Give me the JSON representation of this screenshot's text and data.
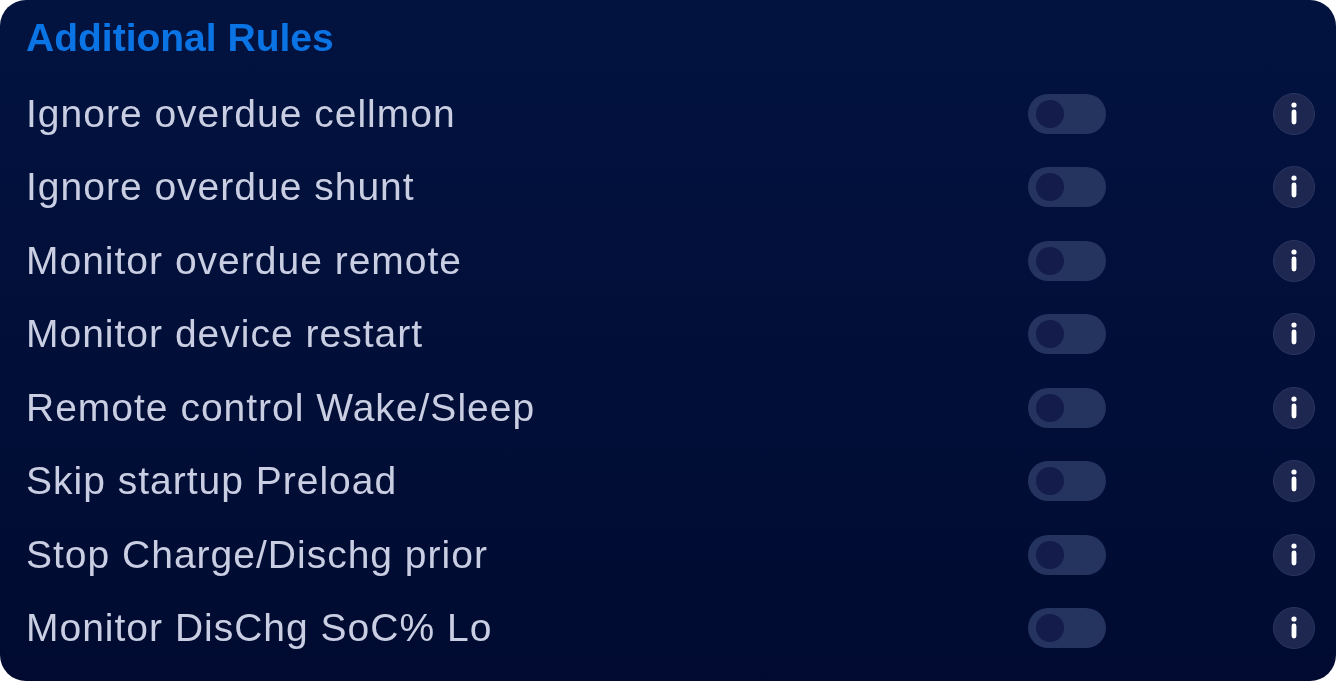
{
  "title": "Additional Rules",
  "rules": [
    {
      "label": "Ignore overdue cellmon",
      "on": false
    },
    {
      "label": "Ignore overdue shunt",
      "on": false
    },
    {
      "label": "Monitor overdue remote",
      "on": false
    },
    {
      "label": "Monitor device restart",
      "on": false
    },
    {
      "label": "Remote control Wake/Sleep",
      "on": false
    },
    {
      "label": "Skip startup Preload",
      "on": false
    },
    {
      "label": "Stop Charge/Dischg prior",
      "on": false
    },
    {
      "label": "Monitor DisChg SoC% Lo",
      "on": false
    }
  ]
}
